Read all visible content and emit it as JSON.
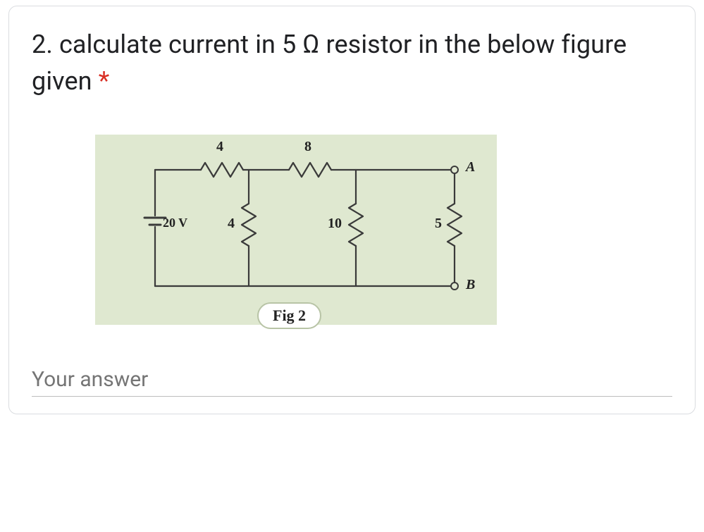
{
  "question": {
    "number_and_text": "2. calculate current in 5 Ω resistor in the below figure given ",
    "required_mark": "*"
  },
  "circuit": {
    "r_top_left": "4",
    "r_top_right": "8",
    "source": "20 V",
    "r_mid1": "4",
    "r_mid2": "10",
    "r_mid3": "5",
    "node_a": "A",
    "node_b": "B",
    "caption": "Fig 2"
  },
  "answer": {
    "placeholder": "Your answer"
  }
}
